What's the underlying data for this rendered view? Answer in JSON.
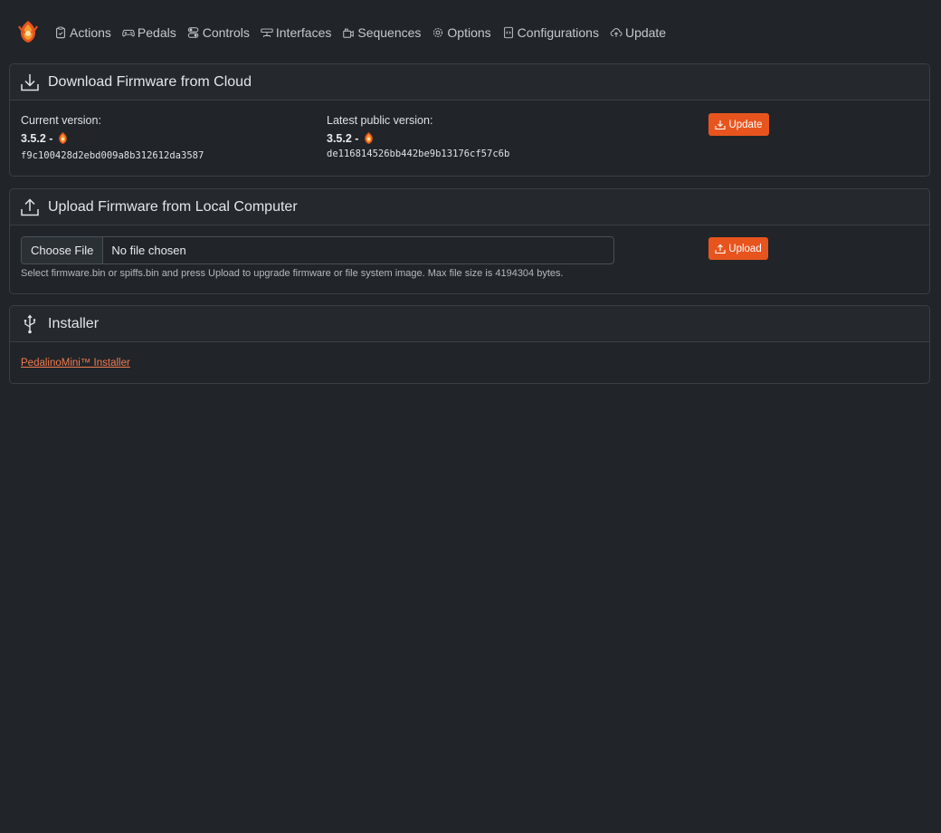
{
  "nav": {
    "items": [
      {
        "label": "Actions",
        "icon": "clipboard-icon"
      },
      {
        "label": "Pedals",
        "icon": "gamepad-icon"
      },
      {
        "label": "Controls",
        "icon": "toggles-icon"
      },
      {
        "label": "Interfaces",
        "icon": "interfaces-icon"
      },
      {
        "label": "Sequences",
        "icon": "sequences-icon"
      },
      {
        "label": "Options",
        "icon": "gear-icon"
      },
      {
        "label": "Configurations",
        "icon": "file-code-icon"
      },
      {
        "label": "Update",
        "icon": "cloud-upload-icon"
      }
    ]
  },
  "download": {
    "title": "Download Firmware from Cloud",
    "current_label": "Current version:",
    "current_version": "3.5.2 -",
    "current_hash": "f9c100428d2ebd009a8b312612da3587",
    "latest_label": "Latest public version:",
    "latest_version": "3.5.2 -",
    "latest_hash": "de116814526bb442be9b13176cf57c6b",
    "button": "Update"
  },
  "upload": {
    "title": "Upload Firmware from Local Computer",
    "choose_file": "Choose File",
    "file_name": "No file chosen",
    "help": "Select firmware.bin or spiffs.bin and press Upload to upgrade firmware or file system image. Max file size is 4194304 bytes.",
    "button": "Upload"
  },
  "installer": {
    "title": "Installer",
    "link": "PedalinoMini™ Installer"
  },
  "colors": {
    "accent": "#e8541e",
    "background": "#212529",
    "link": "#f07a4f"
  }
}
